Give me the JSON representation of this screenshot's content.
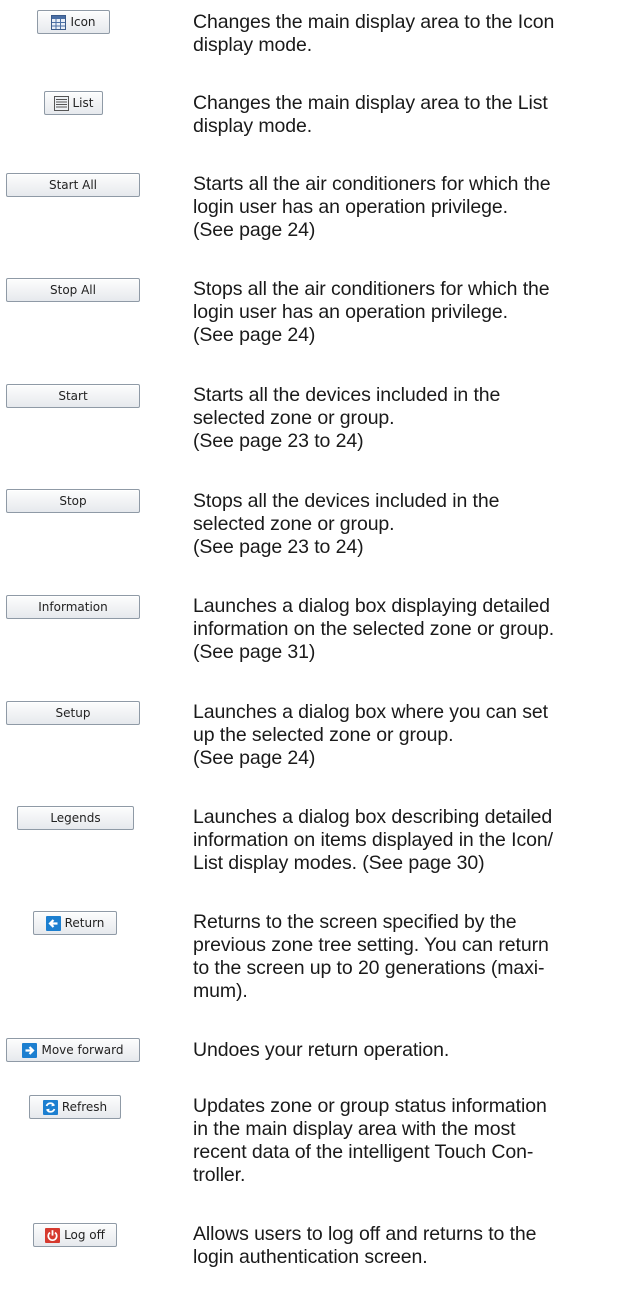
{
  "items": [
    {
      "button": "Icon",
      "icon": "grid-icon",
      "lines": [
        "Changes the main display area to the Icon",
        "display mode."
      ]
    },
    {
      "button": "List",
      "icon": "list-icon",
      "lines": [
        "Changes the main display area to the List",
        "display mode."
      ]
    },
    {
      "button": "Start All",
      "lines": [
        "Starts all the air conditioners for which the",
        "login user has an operation privilege.",
        "(See page 24)"
      ]
    },
    {
      "button": "Stop All",
      "lines": [
        "Stops all the air conditioners for which the",
        "login user has an operation privilege.",
        "(See page 24)"
      ]
    },
    {
      "button": "Start",
      "lines": [
        "Starts all the devices included in the",
        "selected zone or group.",
        "(See page 23 to 24)"
      ]
    },
    {
      "button": "Stop",
      "lines": [
        "Stops all the devices included in the",
        "selected zone or group.",
        "(See page 23 to 24)"
      ]
    },
    {
      "button": "Information",
      "lines": [
        "Launches a dialog box displaying detailed",
        "information on the selected zone or group.",
        "(See page 31)"
      ]
    },
    {
      "button": "Setup",
      "lines": [
        "Launches a dialog box where you can set",
        "up the selected zone or group.",
        "(See page 24)"
      ]
    },
    {
      "button": "Legends",
      "lines": [
        "Launches a dialog box describing detailed",
        "information on items displayed in the Icon/",
        "List display modes. (See page 30)"
      ]
    },
    {
      "button": "Return",
      "icon": "back-arrow-icon",
      "lines": [
        "Returns to the screen specified by the",
        "previous zone tree setting. You can return",
        "to the screen up to 20 generations (maxi-",
        "mum)."
      ]
    },
    {
      "button": "Move forward",
      "icon": "forward-arrow-icon",
      "lines": [
        "Undoes your return operation."
      ]
    },
    {
      "button": "Refresh",
      "icon": "refresh-icon",
      "lines": [
        "Updates zone or group status information",
        "in the main display area with the most",
        "recent data of the intelligent Touch Con-",
        "troller."
      ]
    },
    {
      "button": "Log off",
      "icon": "power-icon",
      "lines": [
        "Allows users to log off and returns to the",
        "login authentication screen."
      ]
    }
  ]
}
